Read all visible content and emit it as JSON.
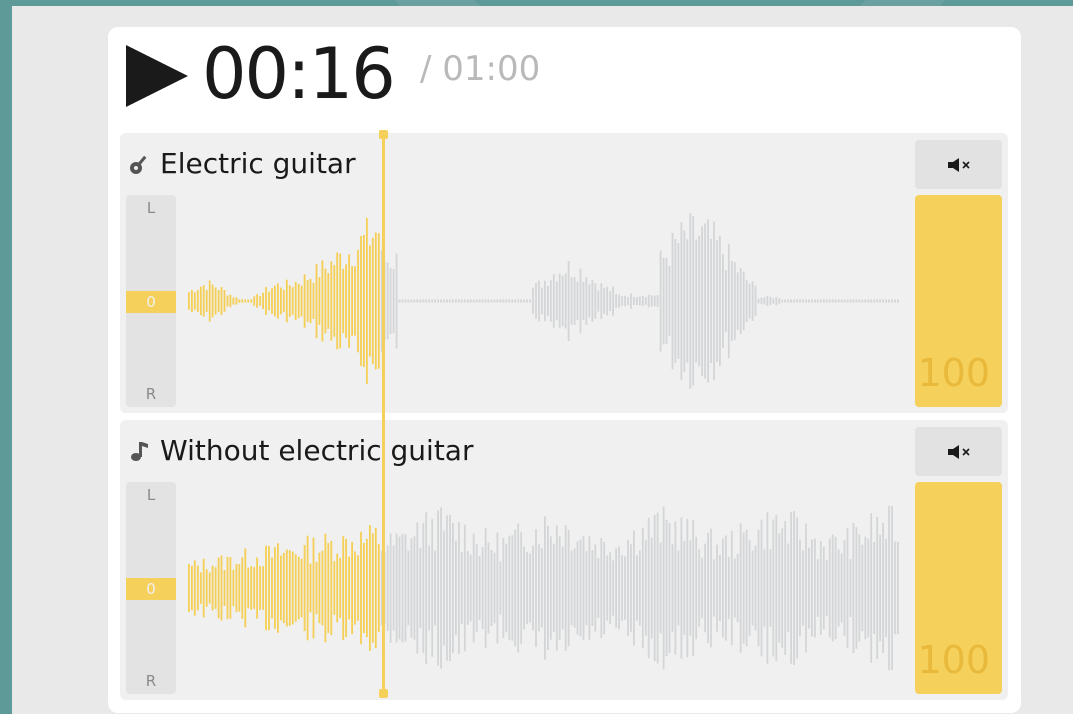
{
  "transport": {
    "current_time": "00:16",
    "total_time": "/ 01:00",
    "play_icon": "play-icon"
  },
  "tracks": [
    {
      "name": "Electric guitar",
      "icon": "electric-guitar-icon",
      "mute_icon": "mute-icon",
      "pan_top": "L",
      "pan_center": "0",
      "pan_bottom": "R",
      "volume": "100",
      "played_fraction": 0.27
    },
    {
      "name": "Without electric guitar",
      "icon": "music-note-icon",
      "mute_icon": "mute-icon",
      "pan_top": "L",
      "pan_center": "0",
      "pan_bottom": "R",
      "volume": "100",
      "played_fraction": 0.27
    }
  ],
  "colors": {
    "accent": "#f5d05b",
    "played": "#f5cf55",
    "unplayed": "#d3d5d7",
    "background": "#5e9a98"
  }
}
